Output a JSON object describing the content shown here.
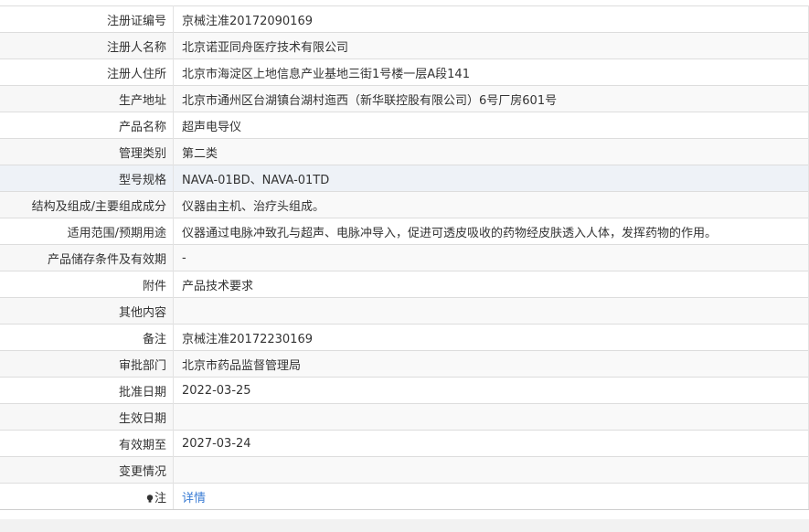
{
  "rows": [
    {
      "label": "注册证编号",
      "value": "京械注准20172090169"
    },
    {
      "label": "注册人名称",
      "value": "北京诺亚同舟医疗技术有限公司"
    },
    {
      "label": "注册人住所",
      "value": "北京市海淀区上地信息产业基地三街1号楼一层A段141"
    },
    {
      "label": "生产地址",
      "value": "北京市通州区台湖镇台湖村迤西（新华联控股有限公司）6号厂房601号"
    },
    {
      "label": "产品名称",
      "value": "超声电导仪"
    },
    {
      "label": "管理类别",
      "value": "第二类"
    },
    {
      "label": "型号规格",
      "value": "NAVA-01BD、NAVA-01TD"
    },
    {
      "label": "结构及组成/主要组成成分",
      "value": "仪器由主机、治疗头组成。"
    },
    {
      "label": "适用范围/预期用途",
      "value": "仪器通过电脉冲致孔与超声、电脉冲导入，促进可透皮吸收的药物经皮肤透入人体，发挥药物的作用。"
    },
    {
      "label": "产品储存条件及有效期",
      "value": "-"
    },
    {
      "label": "附件",
      "value": "产品技术要求"
    },
    {
      "label": "其他内容",
      "value": ""
    },
    {
      "label": "备注",
      "value": "京械注准20172230169"
    },
    {
      "label": "审批部门",
      "value": "北京市药品监督管理局"
    },
    {
      "label": "批准日期",
      "value": "2022-03-25"
    },
    {
      "label": "生效日期",
      "value": ""
    },
    {
      "label": "有效期至",
      "value": "2027-03-24"
    },
    {
      "label": "变更情况",
      "value": ""
    }
  ],
  "note_row": {
    "label": "注",
    "icon": "bulb-icon",
    "link": "详情"
  },
  "colors": {
    "label_bg": "#f7f7f7",
    "highlight_bg": "#eef2f7",
    "link": "#3a7cd4",
    "border": "#dddddd"
  }
}
